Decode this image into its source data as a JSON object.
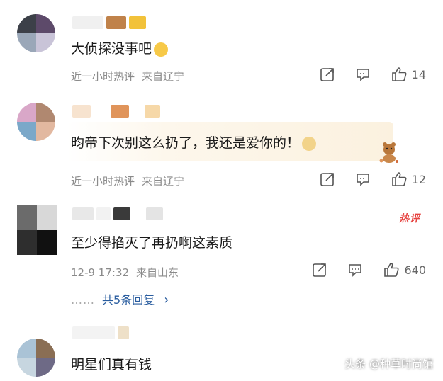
{
  "comments": [
    {
      "text": "大侦探没事吧",
      "meta_time": "近一小时热评",
      "meta_location": "来自辽宁",
      "like_count": "14"
    },
    {
      "text": "昀帝下次别这么扔了，我还是爱你的！",
      "meta_time": "近一小时热评",
      "meta_location": "来自辽宁",
      "like_count": "12"
    },
    {
      "text": "至少得掐灭了再扔啊这素质",
      "meta_time": "12-9 17:32",
      "meta_location": "来自山东",
      "like_count": "640",
      "badge": "热评",
      "reply_link": "共5条回复",
      "reply_chevron": "›",
      "reply_dots": "……"
    },
    {
      "text": "明星们真有钱"
    }
  ],
  "watermark": "头条 @种草时尚馆",
  "icons": {
    "share": "share-icon",
    "reply": "comment-icon",
    "like": "thumbs-up-icon"
  },
  "colors": {
    "link": "#2a5d9f",
    "badge": "#e64340",
    "meta": "#8a8a8a"
  }
}
